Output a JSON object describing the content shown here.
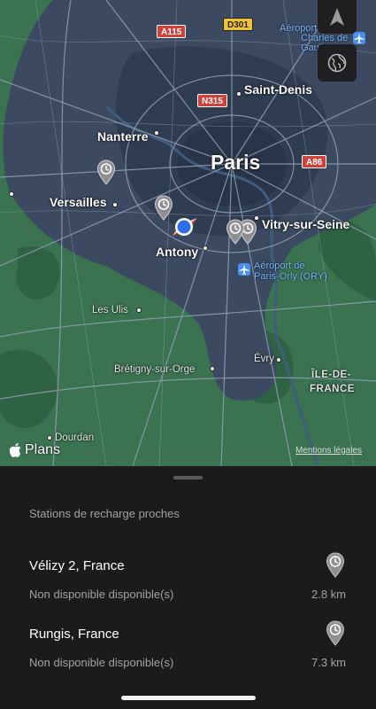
{
  "map": {
    "cities": {
      "paris": "Paris",
      "saint_denis": "Saint-Denis",
      "nanterre": "Nanterre",
      "versailles": "Versailles",
      "antony": "Antony",
      "vitry": "Vitry-sur-Seine",
      "les_ulis": "Les Ulis",
      "bretigny": "Brétigny-sur-Orge",
      "evry": "Évry",
      "dourdan": "Dourdan",
      "region_line1": "ÎLE-DE-",
      "region_line2": "FRANCE"
    },
    "roads": {
      "a115": "A115",
      "d301": "D301",
      "n315": "N315",
      "a86": "A86"
    },
    "airports": {
      "cdg_line1": "Aéroport de",
      "cdg_line2": "Charles de",
      "cdg_line3": "Gaulle",
      "orly_line1": "Aéroport de",
      "orly_line2": "Paris-Orly (ORY)"
    },
    "logo": "Plans",
    "legal": "Mentions légales"
  },
  "sheet": {
    "title": "Stations de recharge proches",
    "stations": [
      {
        "name": "Vélizy 2, France",
        "status": "Non disponible disponible(s)",
        "distance": "2.8 km"
      },
      {
        "name": "Rungis, France",
        "status": "Non disponible disponible(s)",
        "distance": "7.3 km"
      }
    ]
  },
  "colors": {
    "map_green": "#3a7350",
    "urban": "#39485c",
    "water": "#2d4a66",
    "accent_blue": "#2f6df0",
    "shield_red": "#d0413a"
  }
}
